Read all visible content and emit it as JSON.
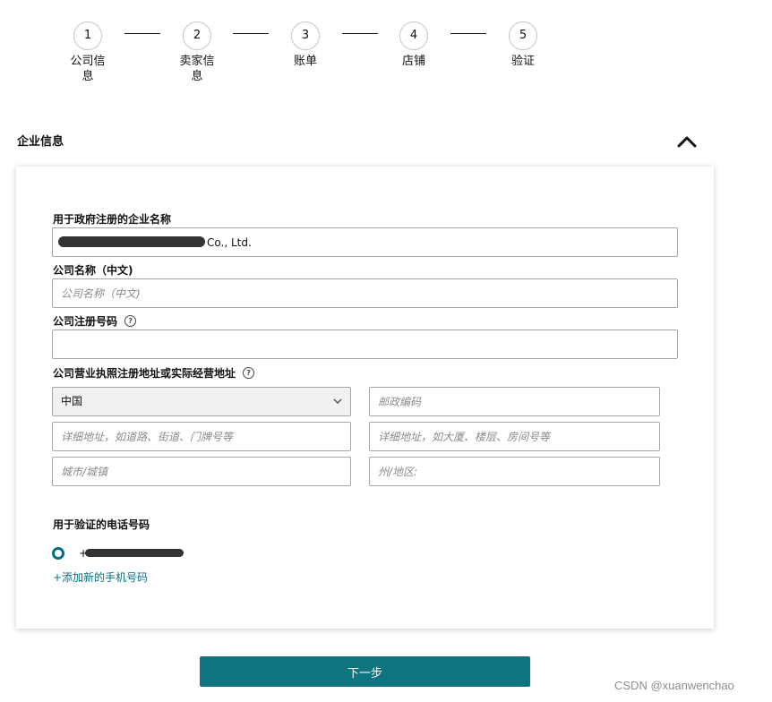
{
  "stepper": {
    "steps": [
      {
        "number": "1",
        "label": "公司信息"
      },
      {
        "number": "2",
        "label": "卖家信息"
      },
      {
        "number": "3",
        "label": "账单"
      },
      {
        "number": "4",
        "label": "店铺"
      },
      {
        "number": "5",
        "label": "验证"
      }
    ]
  },
  "section": {
    "title": "企业信息"
  },
  "form": {
    "registered_name": {
      "label": "用于政府注册的企业名称",
      "value_visible_suffix": "Co., Ltd."
    },
    "company_name_cn": {
      "label": "公司名称（中文)",
      "placeholder": "公司名称（中文)"
    },
    "registration_number": {
      "label": "公司注册号码",
      "value": ""
    },
    "address": {
      "label": "公司营业执照注册地址或实际经营地址",
      "country": "中国",
      "postal_placeholder": "邮政编码",
      "line1_placeholder": "详细地址，如道路、街道、门牌号等",
      "line2_placeholder": "详细地址，如大厦、楼层、房间号等",
      "city_placeholder": "城市/城镇",
      "state_placeholder": "州/地区:"
    },
    "phone": {
      "label": "用于验证的电话号码",
      "value_visible_prefix": "+",
      "add_link": "+添加新的手机号码"
    }
  },
  "actions": {
    "next_label": "下一步"
  },
  "watermark": "CSDN @xuanwenchao",
  "colors": {
    "accent": "#007185",
    "button": "#0f7380"
  }
}
